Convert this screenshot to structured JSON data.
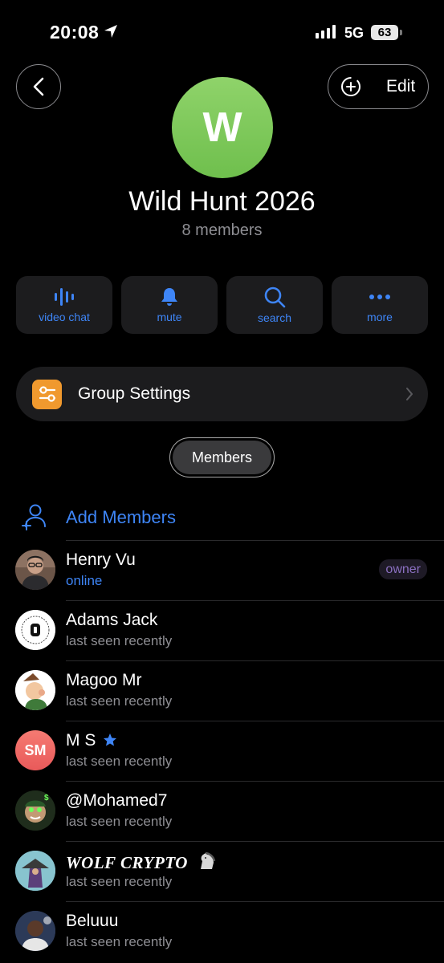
{
  "status_bar": {
    "time": "20:08",
    "network": "5G",
    "battery": "63"
  },
  "header": {
    "edit_label": "Edit"
  },
  "group": {
    "avatar_letter": "W",
    "name": "Wild Hunt 2026",
    "member_count": "8 members",
    "avatar_color": "#7ac858"
  },
  "actions": [
    {
      "label": "video chat",
      "icon": "voice-chat-icon"
    },
    {
      "label": "mute",
      "icon": "bell-icon"
    },
    {
      "label": "search",
      "icon": "search-icon"
    },
    {
      "label": "more",
      "icon": "more-dots-icon"
    }
  ],
  "settings": {
    "label": "Group Settings",
    "icon": "sliders-icon",
    "icon_color": "#f0992e"
  },
  "members_tab": {
    "label": "Members"
  },
  "add_members": {
    "label": "Add Members",
    "icon": "add-person-icon"
  },
  "members": [
    {
      "name": "Henry Vu",
      "status": "online",
      "badge": "owner"
    },
    {
      "name": "Adams Jack",
      "status": "last seen recently"
    },
    {
      "name": "Magoo Mr",
      "status": "last seen recently"
    },
    {
      "name": "M S",
      "initials": "SM",
      "status": "last seen recently",
      "badge_icon": "star-icon"
    },
    {
      "name": "@Mohamed7",
      "status": "last seen recently"
    },
    {
      "name": "WOLF CRYPTO",
      "status": "last seen recently",
      "badge_icon": "horse-emoji"
    },
    {
      "name": "Beluuu",
      "status": "last seen recently"
    }
  ],
  "colors": {
    "accent": "#3e85f6",
    "background": "#000000",
    "surface": "#1c1c1e",
    "owner_badge": "#8a6fc0"
  }
}
